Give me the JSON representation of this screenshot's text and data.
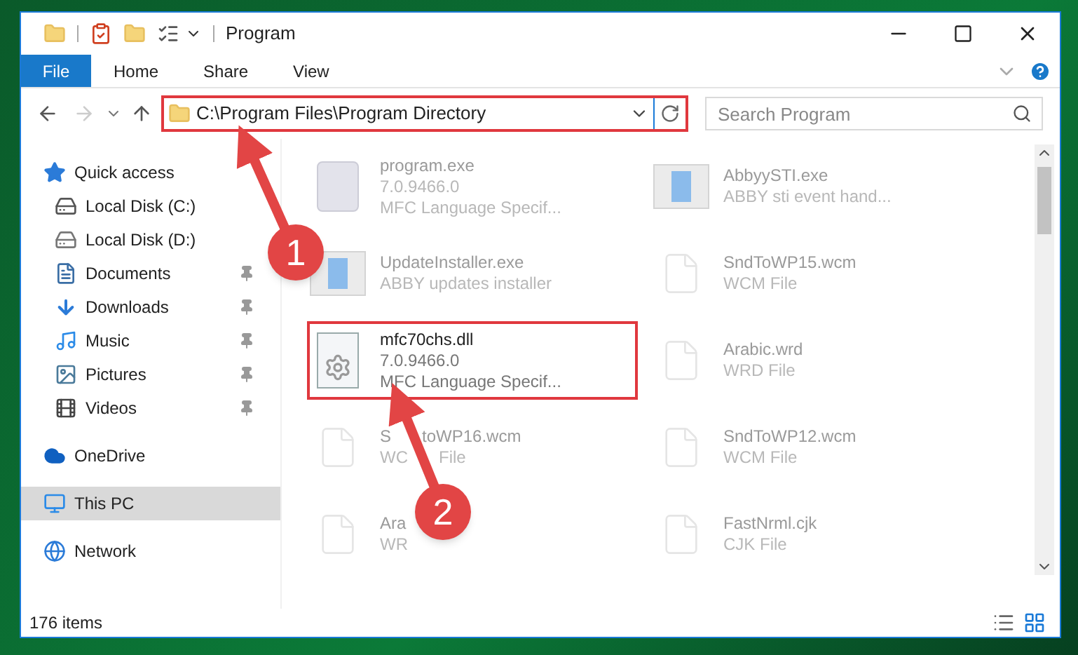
{
  "window": {
    "title": "Program"
  },
  "ribbon": {
    "tabs": [
      {
        "label": "File",
        "selected": true
      },
      {
        "label": "Home",
        "selected": false
      },
      {
        "label": "Share",
        "selected": false
      },
      {
        "label": "View",
        "selected": false
      }
    ]
  },
  "address_bar": {
    "path": "C:\\Program Files\\Program Directory",
    "highlighted": true
  },
  "search": {
    "placeholder": "Search Program"
  },
  "sidebar": {
    "items": [
      {
        "label": "Quick access",
        "kind": "quick",
        "selected": false,
        "children": [
          {
            "label": "Local Disk (C:)",
            "kind": "drive-system",
            "pinned": false
          },
          {
            "label": "Local Disk (D:)",
            "kind": "drive",
            "pinned": false
          },
          {
            "label": "Documents",
            "kind": "documents",
            "pinned": true
          },
          {
            "label": "Downloads",
            "kind": "downloads",
            "pinned": true
          },
          {
            "label": "Music",
            "kind": "music",
            "pinned": true
          },
          {
            "label": "Pictures",
            "kind": "pictures",
            "pinned": true
          },
          {
            "label": "Videos",
            "kind": "videos",
            "pinned": true
          }
        ]
      },
      {
        "label": "OneDrive",
        "kind": "onedrive",
        "selected": false
      },
      {
        "label": "This PC",
        "kind": "pc",
        "selected": true
      },
      {
        "label": "Network",
        "kind": "network",
        "selected": false
      }
    ]
  },
  "files": [
    {
      "name": [
        "program.exe"
      ],
      "details": [
        [
          "7.0.9466.0"
        ],
        [
          "MFC Language Specif..."
        ]
      ],
      "kind": "app",
      "highlighted": false
    },
    {
      "name": [
        "AbbyySTI.exe"
      ],
      "details": [
        [
          "ABBY sti event hand..."
        ]
      ],
      "kind": "window",
      "highlighted": false
    },
    {
      "name": [
        "UpdateInstaller.exe"
      ],
      "details": [
        [
          "ABBY updates installer"
        ]
      ],
      "kind": "window",
      "highlighted": false
    },
    {
      "name": [
        "SndToWP15.wcm"
      ],
      "details": [
        [
          "WCM File"
        ]
      ],
      "kind": "blank",
      "highlighted": false
    },
    {
      "name": [
        "mfc70chs.dll"
      ],
      "details": [
        [
          "7.0.9466.0"
        ],
        [
          "MFC Language Specif..."
        ]
      ],
      "kind": "dll",
      "highlighted": true
    },
    {
      "name": [
        "Arabic.wrd"
      ],
      "details": [
        [
          "WRD File"
        ]
      ],
      "kind": "blank",
      "highlighted": false
    },
    {
      "name": [
        "S",
        "toWP16.wcm"
      ],
      "details": [
        [
          "WC",
          "File"
        ]
      ],
      "kind": "blank",
      "highlighted": false
    },
    {
      "name": [
        "SndToWP12.wcm"
      ],
      "details": [
        [
          "WCM File"
        ]
      ],
      "kind": "blank",
      "highlighted": false
    },
    {
      "name": [
        "Ara"
      ],
      "details": [
        [
          "WR"
        ]
      ],
      "kind": "blank",
      "highlighted": false
    },
    {
      "name": [
        "FastNrml.cjk"
      ],
      "details": [
        [
          "CJK File"
        ]
      ],
      "kind": "blank",
      "highlighted": false
    }
  ],
  "status_bar": {
    "item_count": "176 items"
  },
  "annotations": [
    {
      "number": "1"
    },
    {
      "number": "2"
    }
  ]
}
